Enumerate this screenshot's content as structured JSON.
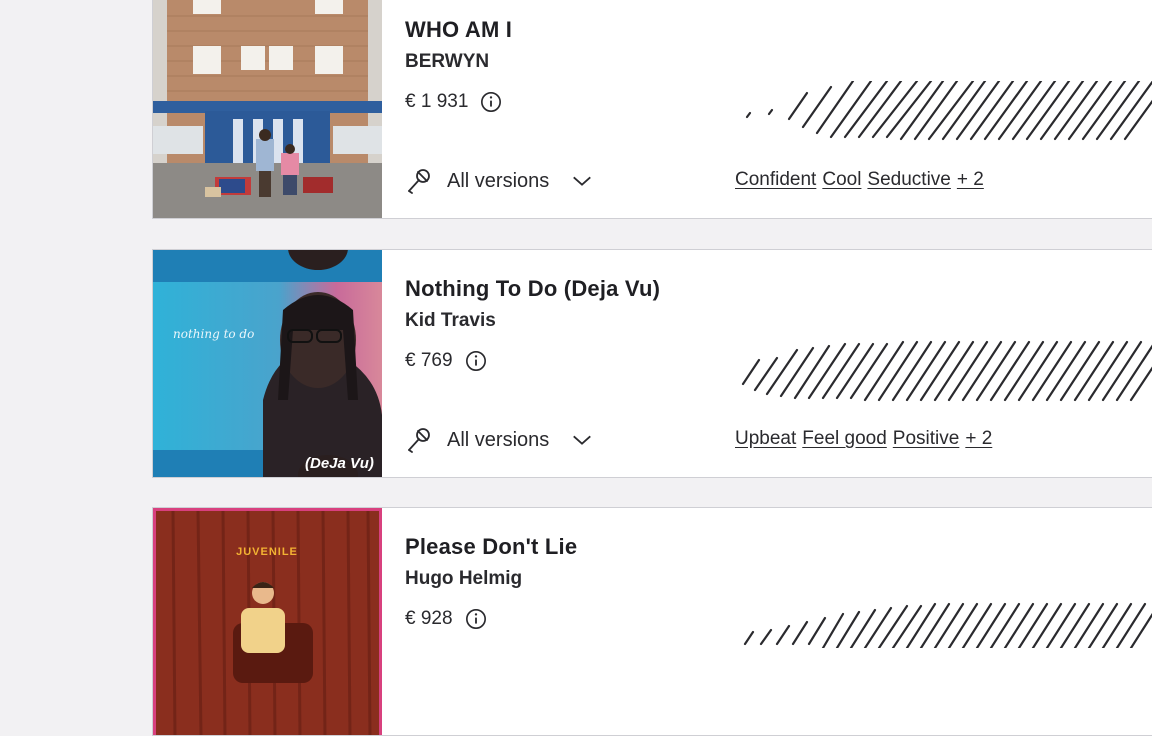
{
  "tracks": [
    {
      "title": "WHO AM I",
      "artist": "BERWYN",
      "price": "€ 1 931",
      "versions_label": "All versions",
      "tags": [
        "Confident",
        "Cool",
        "Seductive"
      ],
      "more_tags": "+ 2"
    },
    {
      "title": "Nothing To Do (Deja Vu)",
      "artist": "Kid Travis",
      "price": "€ 769",
      "versions_label": "All versions",
      "tags": [
        "Upbeat",
        "Feel good",
        "Positive"
      ],
      "more_tags": "+ 2",
      "cover_caption": "(DeJa Vu)",
      "cover_script": "nothing to do"
    },
    {
      "title": "Please Don't Lie",
      "artist": "Hugo Helmig",
      "price": "€ 928",
      "cover_caption": "JUVENILE"
    }
  ],
  "icons": {
    "info": "info-circle-icon",
    "mic": "microphone-icon",
    "chevron": "chevron-down-icon"
  },
  "colors": {
    "background": "#f2f1f3",
    "card": "#ffffff",
    "border": "#cfcfd4",
    "text": "#1f1f23"
  }
}
